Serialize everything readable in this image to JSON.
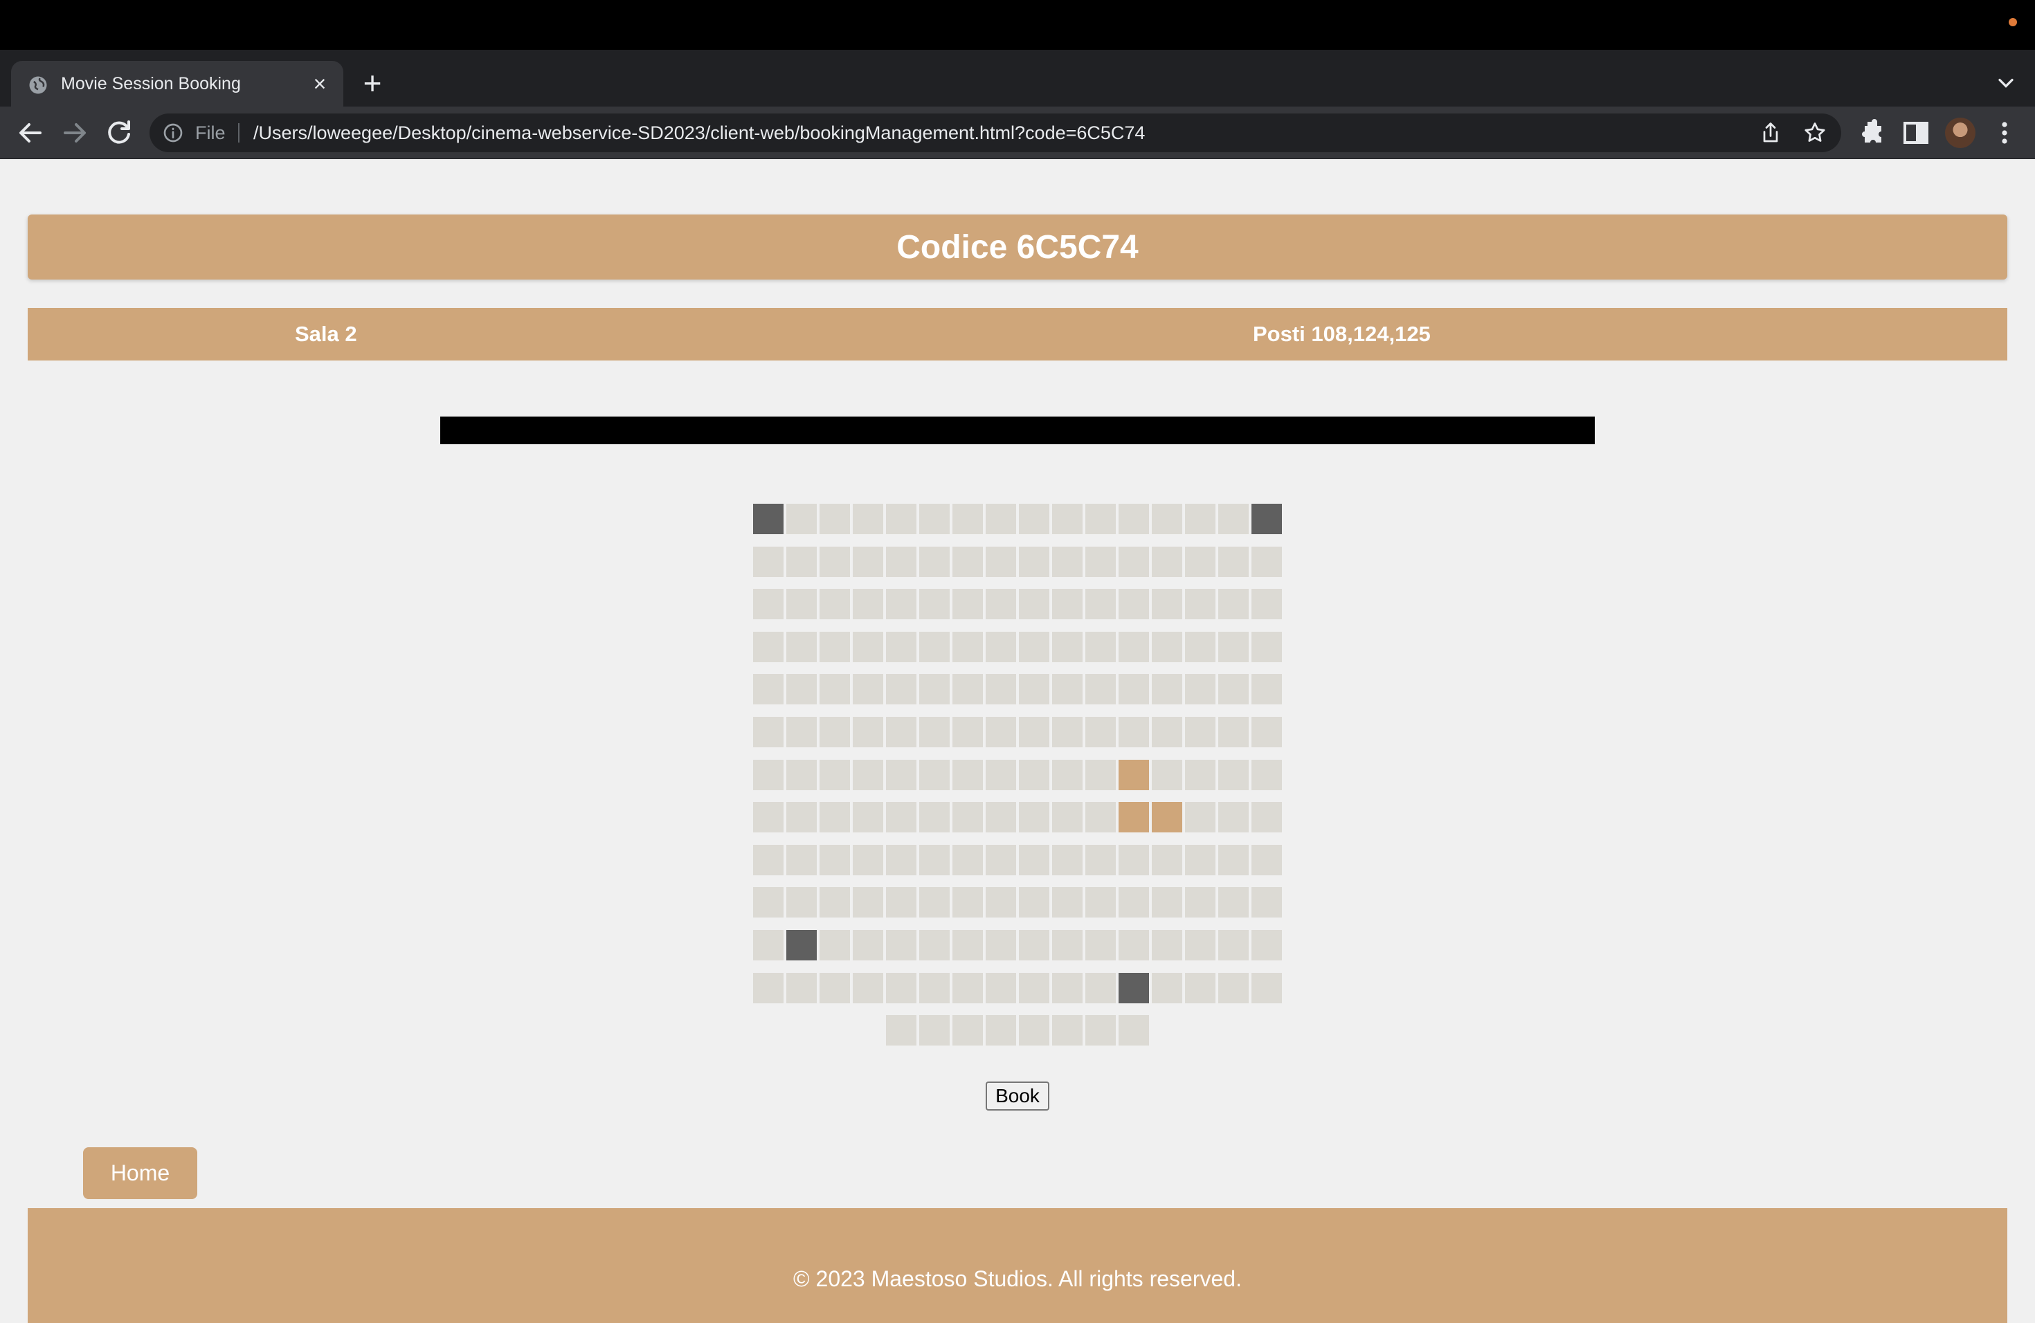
{
  "browser": {
    "tab_title": "Movie Session Booking",
    "tab_close": "×",
    "new_tab": "+",
    "url_scheme": "File",
    "url": "/Users/loweegee/Desktop/cinema-webservice-SD2023/client-web/bookingManagement.html?code=6C5C74"
  },
  "page": {
    "title": "Codice 6C5C74",
    "sala": "Sala 2",
    "posti": "Posti 108,124,125",
    "book_label": "Book",
    "home_label": "Home",
    "footer": "© 2023 Maestoso Studios. All rights reserved."
  },
  "colors": {
    "accent": "#cfa67a",
    "seat_free": "#dcdad4",
    "seat_taken": "#5f5f5f",
    "seat_selected": "#cfa67a",
    "screen": "#000000"
  },
  "seating": {
    "rows": 12,
    "columns": 16,
    "last_row_columns": [
      4,
      5,
      6,
      7,
      8,
      9,
      10,
      11
    ],
    "taken_seats": [
      1,
      16,
      162,
      188
    ],
    "selected_seats": [
      108,
      124,
      125
    ]
  }
}
